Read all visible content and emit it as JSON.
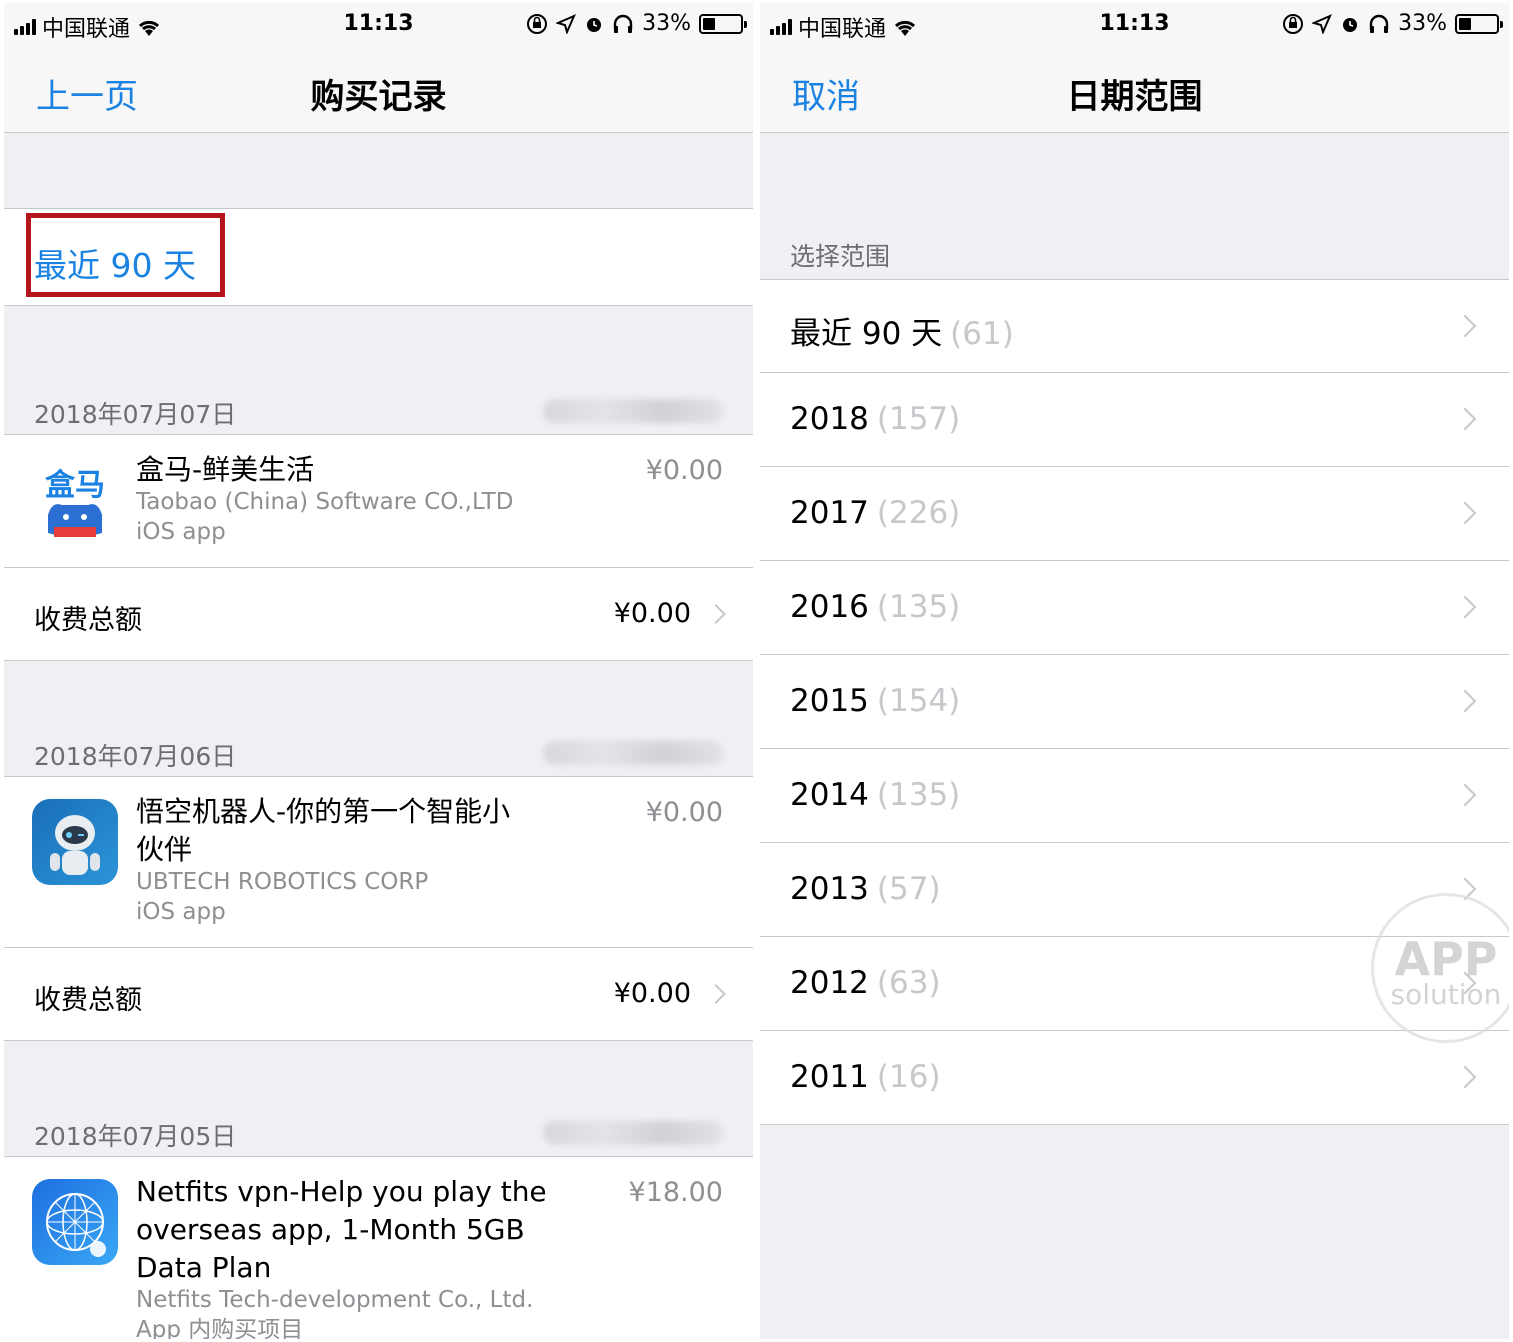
{
  "left": {
    "status": {
      "carrier": "中国联通",
      "time": "11:13",
      "battery": "33%",
      "battery_level": 0.33
    },
    "nav": {
      "back": "上一页",
      "title": "购买记录"
    },
    "filter": {
      "label": "最近 90 天"
    },
    "groups": [
      {
        "date": "2018年07月07日",
        "item": {
          "name": "盒马-鲜美生活",
          "developer": "Taobao (China) Software CO.,LTD",
          "type": "iOS app",
          "price": "¥0.00",
          "icon": "hema-app-icon"
        },
        "total_label": "收费总额",
        "total": "¥0.00"
      },
      {
        "date": "2018年07月06日",
        "item": {
          "name": "悟空机器人-你的第一个智能小伙伴",
          "developer": "UBTECH ROBOTICS CORP",
          "type": "iOS app",
          "price": "¥0.00",
          "icon": "robot-app-icon"
        },
        "total_label": "收费总额",
        "total": "¥0.00"
      },
      {
        "date": "2018年07月05日",
        "item": {
          "name": "Netfits vpn-Help you play the overseas app, 1-Month 5GB Data Plan",
          "developer": "Netfits Tech-development Co., Ltd.",
          "type": "App 内购买项目",
          "price": "¥18.00",
          "icon": "globe-app-icon"
        }
      }
    ]
  },
  "right": {
    "status": {
      "carrier": "中国联通",
      "time": "11:13",
      "battery": "33%",
      "battery_level": 0.33
    },
    "nav": {
      "cancel": "取消",
      "title": "日期范围"
    },
    "section_header": "选择范围",
    "ranges": [
      {
        "label": "最近 90 天",
        "count": "(61)"
      },
      {
        "label": "2018",
        "count": "(157)"
      },
      {
        "label": "2017",
        "count": "(226)"
      },
      {
        "label": "2016",
        "count": "(135)"
      },
      {
        "label": "2015",
        "count": "(154)"
      },
      {
        "label": "2014",
        "count": "(135)"
      },
      {
        "label": "2013",
        "count": "(57)"
      },
      {
        "label": "2012",
        "count": "(63)"
      },
      {
        "label": "2011",
        "count": "(16)"
      }
    ]
  },
  "watermark": {
    "line1": "APP",
    "line2": "solution"
  },
  "colors": {
    "accent": "#1a82e2",
    "highlight_box": "#b5151b",
    "background": "#efeff4"
  }
}
